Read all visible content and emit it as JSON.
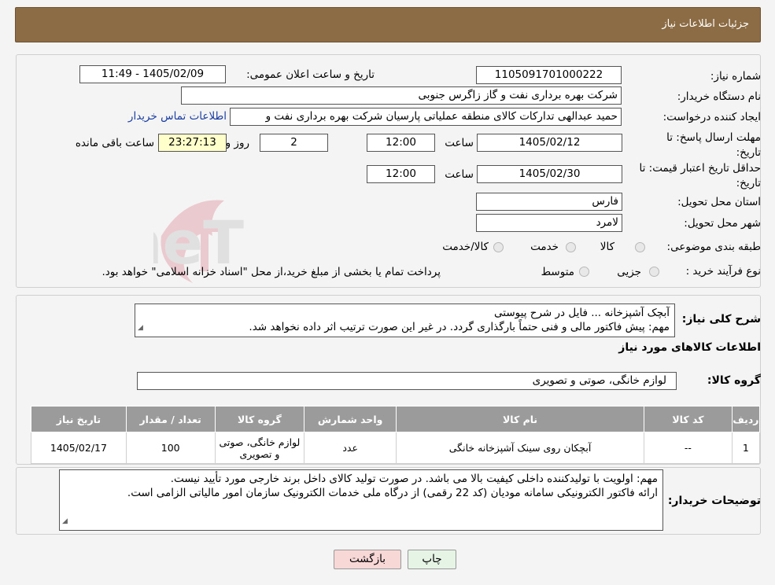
{
  "header": {
    "title": "جزئیات اطلاعات نیاز"
  },
  "form": {
    "need_number": {
      "label": "شماره نیاز:",
      "value": "1105091701000222"
    },
    "announce_datetime": {
      "label": "تاریخ و ساعت اعلان عمومی:",
      "value": "1405/02/09 - 11:49"
    },
    "buyer_org": {
      "label": "نام دستگاه خریدار:",
      "value": "شرکت بهره برداری نفت و گاز زاگرس جنوبی"
    },
    "requester": {
      "label": "ایجاد کننده درخواست:",
      "value": "حمید عبدالهی تداركات كالای منطقه عملیاتی پارسیان شرکت بهره برداری نفت و",
      "contact_link": "اطلاعات تماس خریدار"
    },
    "reply_deadline": {
      "label": "مهلت ارسال پاسخ: تا تاریخ:",
      "date": "1405/02/12",
      "time_label": "ساعت",
      "time": "12:00",
      "days": "2",
      "days_label": "روز و",
      "remaining": "23:27:13",
      "remaining_label": "ساعت باقی مانده"
    },
    "price_validity": {
      "label": "حداقل تاریخ اعتبار قیمت: تا تاریخ:",
      "date": "1405/02/30",
      "time_label": "ساعت",
      "time": "12:00"
    },
    "province": {
      "label": "استان محل تحویل:",
      "value": "فارس"
    },
    "city": {
      "label": "شهر محل تحویل:",
      "value": "لامرد"
    },
    "category": {
      "label": "طبقه بندی موضوعی:",
      "options": [
        "کالا",
        "خدمت",
        "کالا/خدمت"
      ]
    },
    "purchase_type": {
      "label": "نوع فرآیند خرید :",
      "options": [
        "جزیی",
        "متوسط"
      ],
      "note": "پرداخت تمام یا بخشی از مبلغ خرید،از محل \"اسناد خزانه اسلامی\" خواهد بود."
    }
  },
  "description": {
    "label": "شرح کلی نیاز:",
    "line1": "آبچک آشپزخانه ... فایل در شرح پیوستی",
    "line2": "مهم: پیش فاکتور مالی و فنی حتماً بارگذاری گردد. در غیر این صورت ترتیب اثر داده نخواهد شد."
  },
  "goods_section": {
    "title": "اطلاعات کالاهای مورد نیاز"
  },
  "goods_group": {
    "label": "گروه کالا:",
    "value": "لوازم خانگی، صوتی و تصویری"
  },
  "table": {
    "headers": [
      "ردیف",
      "کد کالا",
      "نام کالا",
      "واحد شمارش",
      "گروه کالا",
      "تعداد / مقدار",
      "تاریخ نیاز"
    ],
    "rows": [
      [
        "1",
        "--",
        "آبچکان روی سینک آشپزخانه خانگی",
        "عدد",
        "لوازم خانگی، صوتی و تصویری",
        "100",
        "1405/02/17"
      ]
    ]
  },
  "buyer_notes": {
    "label": "توضیحات خریدار:",
    "line1": "مهم: اولویت با تولیدکننده داخلی کیفیت بالا می باشد. در صورت تولید کالای داخل برند خارجی مورد تأیید نیست.",
    "line2": "ارائه فاکتور الکترونیکی سامانه مودیان (کد 22 رقمی) از درگاه ملی خدمات الکترونیک سازمان امور مالیاتی الزامی است."
  },
  "buttons": {
    "print": "چاپ",
    "back": "بازگشت"
  },
  "watermark": {
    "text": "AriaTender.neT"
  },
  "colors": {
    "header_bg": "#8b6c44",
    "table_header_bg": "#9b9b9b",
    "link": "#1a3ea3",
    "remaining_bg": "#ffffcc",
    "back_button_bg": "#f8d7d7",
    "print_button_bg": "#e6f4e6"
  }
}
